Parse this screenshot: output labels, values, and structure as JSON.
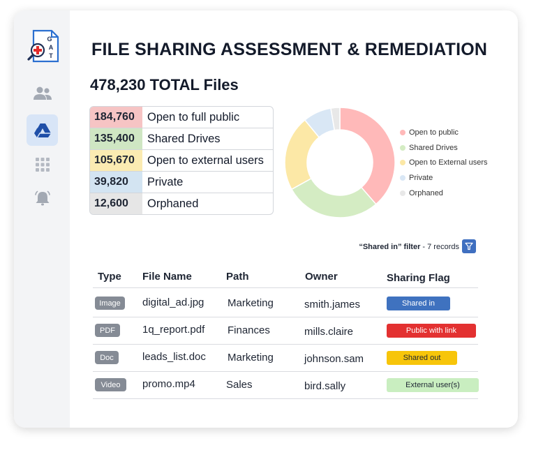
{
  "app": {
    "logo_letters": [
      "G",
      "A",
      "T"
    ]
  },
  "sidebar": {
    "items": [
      {
        "icon": "users-icon",
        "active": false
      },
      {
        "icon": "google-drive-icon",
        "active": true
      },
      {
        "icon": "apps-grid-icon",
        "active": false
      },
      {
        "icon": "bell-icon",
        "active": false
      }
    ]
  },
  "header": {
    "title": "FILE SHARING ASSESSMENT & REMEDIATION",
    "total": "478,230 TOTAL Files"
  },
  "stats": [
    {
      "value": "184,760",
      "label": "Open to full public",
      "color": "#f6c4c4"
    },
    {
      "value": "135,400",
      "label": "Shared Drives",
      "color": "#cfe6c3"
    },
    {
      "value": "105,670",
      "label": "Open to external users",
      "color": "#fbebb2"
    },
    {
      "value": "39,820",
      "label": "Private",
      "color": "#d3e4f2"
    },
    {
      "value": "12,600",
      "label": "Orphaned",
      "color": "#e6e6e6"
    }
  ],
  "chart_data": {
    "type": "pie",
    "categories": [
      "Open to public",
      "Shared Drives",
      "Open to External users",
      "Private",
      "Orphaned"
    ],
    "values": [
      184760,
      135400,
      105670,
      39820,
      12600
    ],
    "colors": [
      "#ffb9b9",
      "#d4ecc3",
      "#fce8a6",
      "#d9e7f5",
      "#e8e8e8"
    ],
    "legend": "right"
  },
  "filter": {
    "label": "“Shared in” filter",
    "suffix": " - 7 records"
  },
  "table": {
    "headers": [
      "Type",
      "File Name",
      "Path",
      "Owner",
      "Sharing Flag"
    ],
    "rows": [
      {
        "type": "Image",
        "file": "digital_ad.jpg",
        "path": "Marketing",
        "owner": "smith.james",
        "flag": "Shared in",
        "flag_bg": "#3f72bf",
        "flag_fg": "#ffffff"
      },
      {
        "type": "PDF",
        "file": "1q_report.pdf",
        "path": "Finances",
        "owner": "mills.claire",
        "flag": "Public with link",
        "flag_bg": "#e33131",
        "flag_fg": "#ffffff"
      },
      {
        "type": "Doc",
        "file": "leads_list.doc",
        "path": "Marketing",
        "owner": "johnson.sam",
        "flag": "Shared out",
        "flag_bg": "#f7c50a",
        "flag_fg": "#1e2533"
      },
      {
        "type": "Video",
        "file": "promo.mp4",
        "path": "Sales",
        "owner": "bird.sally",
        "flag": "External user(s)",
        "flag_bg": "#c9eec0",
        "flag_fg": "#1e2533"
      }
    ]
  }
}
